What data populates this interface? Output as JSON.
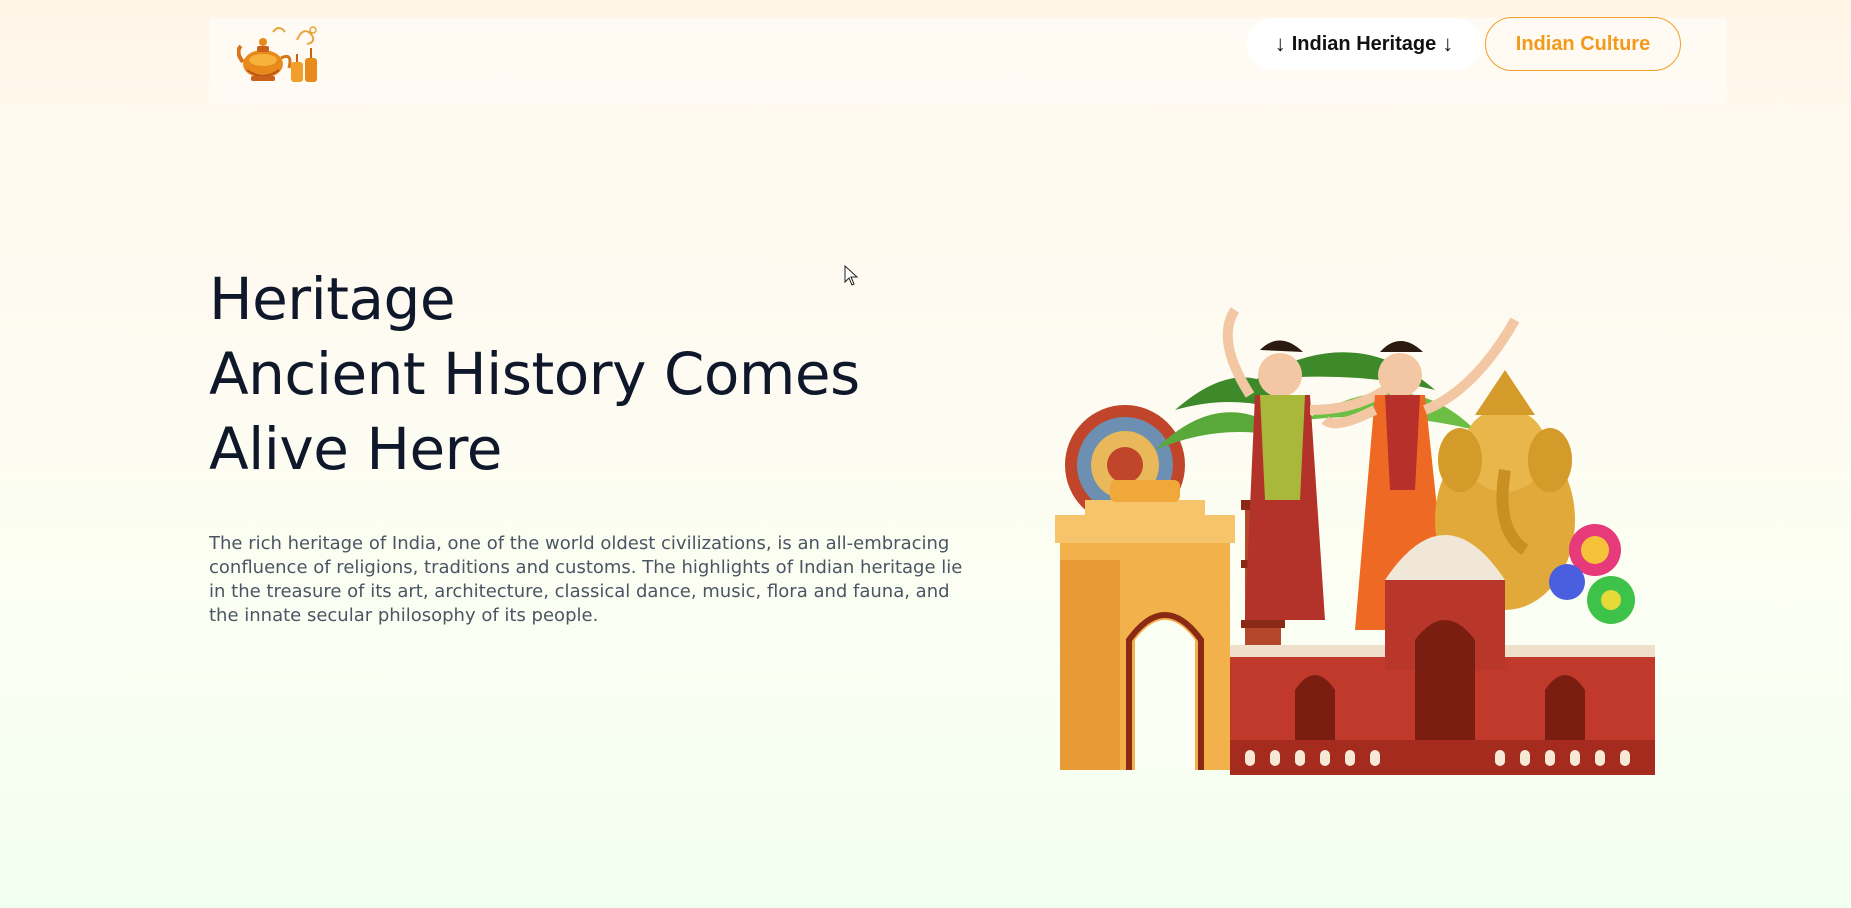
{
  "header": {
    "logo_name": "teapot-lamp-logo",
    "nav_heritage": {
      "arrow_left": "↓",
      "label": "Indian Heritage",
      "arrow_right": "↓"
    },
    "nav_culture_label": "Indian Culture"
  },
  "hero": {
    "title_lines": [
      "Heritage",
      "Ancient History Comes",
      "Alive Here"
    ],
    "description": "The rich heritage of India, one of the world oldest civilizations, is an all-embracing confluence of religions, traditions and customs. The highlights of Indian heritage lie in the treasure of its art, architecture, classical dance, music, flora and fauna, and the innate secular philosophy of its people.",
    "illustration_name": "indian-heritage-collage"
  },
  "colors": {
    "accent": "#f29a1a",
    "title": "#0f172a",
    "body_text": "#4b5563"
  }
}
